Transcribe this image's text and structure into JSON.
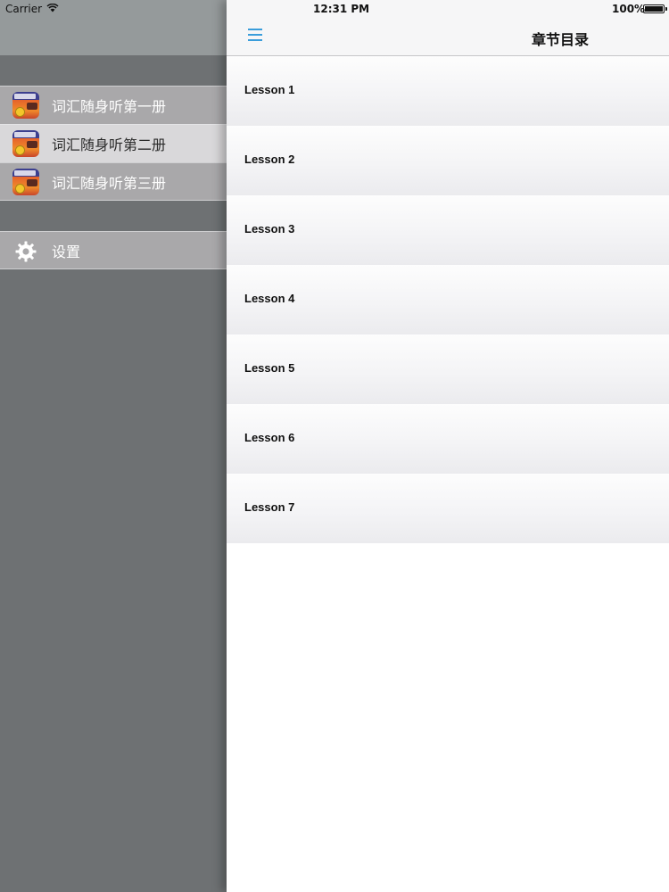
{
  "status_bar": {
    "carrier": "Carrier",
    "time": "12:31 PM",
    "battery": "100%"
  },
  "sidebar": {
    "books": [
      {
        "label": "词汇随身听第一册"
      },
      {
        "label": "词汇随身听第二册"
      },
      {
        "label": "词汇随身听第三册"
      }
    ],
    "settings_label": "设置"
  },
  "header": {
    "title": "章节目录"
  },
  "lessons": [
    "Lesson 1",
    "Lesson 2",
    "Lesson 3",
    "Lesson 4",
    "Lesson 5",
    "Lesson 6",
    "Lesson 7"
  ],
  "colors": {
    "accent": "#3a9ddb",
    "sidebar_bg": "#6e7173",
    "selected_item_bg": "#d9d8da"
  }
}
